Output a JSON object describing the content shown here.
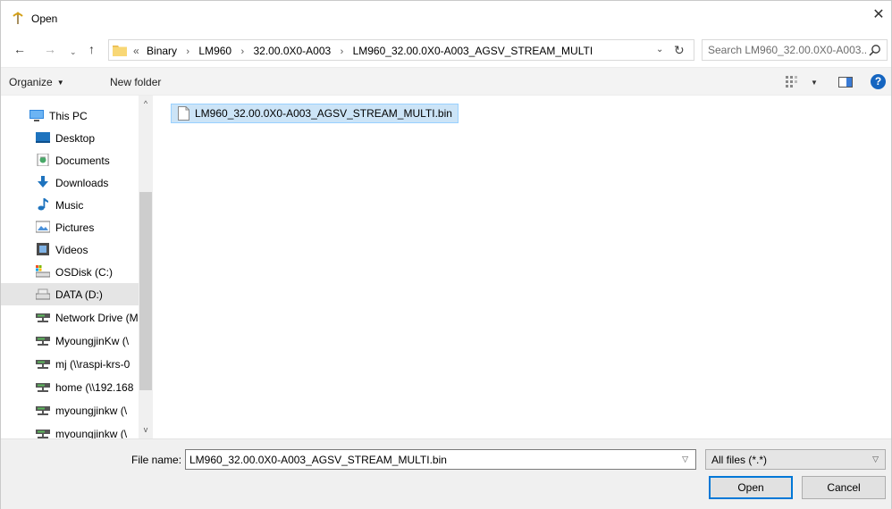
{
  "window": {
    "title": "Open",
    "close_glyph": "✕"
  },
  "nav": {
    "back_glyph": "←",
    "forward_glyph": "→",
    "recent_glyph": "⌄",
    "up_glyph": "↑",
    "refresh_glyph": "↻",
    "dropdown_glyph": "⌄"
  },
  "address": {
    "overflow": "«",
    "crumbs": [
      "Binary",
      "LM960",
      "32.00.0X0-A003",
      "LM960_32.00.0X0-A003_AGSV_STREAM_MULTI"
    ],
    "separator": "›"
  },
  "search": {
    "placeholder": "Search LM960_32.00.0X0-A003..."
  },
  "toolbar": {
    "organize_label": "Organize",
    "new_folder_label": "New folder",
    "help_glyph": "?"
  },
  "navpane": {
    "items": [
      {
        "label": "This PC",
        "icon": "computer-icon"
      },
      {
        "label": "Desktop",
        "icon": "desktop-icon"
      },
      {
        "label": "Documents",
        "icon": "documents-icon"
      },
      {
        "label": "Downloads",
        "icon": "downloads-icon"
      },
      {
        "label": "Music",
        "icon": "music-icon"
      },
      {
        "label": "Pictures",
        "icon": "pictures-icon"
      },
      {
        "label": "Videos",
        "icon": "videos-icon"
      },
      {
        "label": "OSDisk (C:)",
        "icon": "os-drive-icon"
      },
      {
        "label": "DATA (D:)",
        "icon": "drive-icon"
      },
      {
        "label": "Network Drive (M",
        "icon": "network-drive-icon"
      },
      {
        "label": "MyoungjinKw (\\",
        "icon": "network-drive-icon"
      },
      {
        "label": "mj (\\\\raspi-krs-0",
        "icon": "network-drive-icon"
      },
      {
        "label": "home (\\\\192.168",
        "icon": "network-drive-icon"
      },
      {
        "label": "myoungjinkw (\\",
        "icon": "network-drive-icon"
      },
      {
        "label": "myoungjinkw (\\",
        "icon": "network-drive-icon"
      }
    ],
    "selected_index": 8
  },
  "files": [
    {
      "name": "LM960_32.00.0X0-A003_AGSV_STREAM_MULTI.bin",
      "icon": "file-icon",
      "selected": true
    }
  ],
  "footer": {
    "file_name_label": "File name:",
    "file_name_value": "LM960_32.00.0X0-A003_AGSV_STREAM_MULTI.bin",
    "file_type_value": "All files (*.*)",
    "open_label": "Open",
    "cancel_label": "Cancel"
  },
  "colors": {
    "selection": "#cce4f7",
    "selection_border": "#99d1ff",
    "accent": "#0078d7",
    "help": "#1565c0"
  }
}
